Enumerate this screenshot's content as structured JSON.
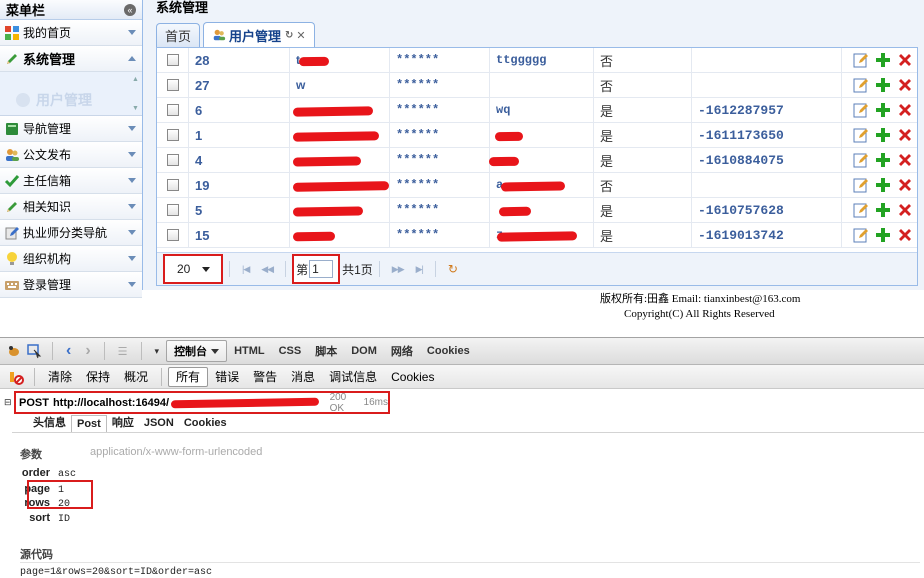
{
  "sidebar": {
    "title": "菜单栏",
    "items": [
      {
        "label": "我的首页",
        "icon": "grid-icon",
        "expanded": false
      },
      {
        "label": "系统管理",
        "icon": "pencil-icon",
        "expanded": true
      },
      {
        "label": "导航管理",
        "icon": "book-icon",
        "expanded": false
      },
      {
        "label": "公文发布",
        "icon": "users-icon",
        "expanded": false
      },
      {
        "label": "主任信箱",
        "icon": "check-icon",
        "expanded": false
      },
      {
        "label": "相关知识",
        "icon": "pencil-icon",
        "expanded": false
      },
      {
        "label": "执业师分类导航",
        "icon": "edit-icon",
        "expanded": false
      },
      {
        "label": "组织机构",
        "icon": "bulb-icon",
        "expanded": false
      },
      {
        "label": "登录管理",
        "icon": "keyboard-icon",
        "expanded": false
      }
    ],
    "sub_item_label": "用户管理"
  },
  "main": {
    "title": "系统管理",
    "tabs": [
      {
        "label": "首页",
        "active": false
      },
      {
        "label": "用户管理",
        "active": true
      }
    ],
    "rows": [
      {
        "id": "28",
        "name": "t",
        "pwd": "******",
        "alias": "ttggggg",
        "flag": "否",
        "phone": ""
      },
      {
        "id": "27",
        "name": "w",
        "pwd": "******",
        "alias": "",
        "flag": "否",
        "phone": ""
      },
      {
        "id": "6",
        "name": "",
        "pwd": "******",
        "alias": "wq",
        "flag": "是",
        "phone": "-1612287957"
      },
      {
        "id": "1",
        "name": "",
        "pwd": "******",
        "alias": "",
        "flag": "是",
        "phone": "-1611173650"
      },
      {
        "id": "4",
        "name": "",
        "pwd": "******",
        "alias": "",
        "flag": "是",
        "phone": "-1610884075"
      },
      {
        "id": "19",
        "name": "",
        "pwd": "******",
        "alias": "a",
        "flag": "否",
        "phone": ""
      },
      {
        "id": "5",
        "name": "",
        "pwd": "******",
        "alias": "",
        "flag": "是",
        "phone": "-1610757628"
      },
      {
        "id": "15",
        "name": "",
        "pwd": "******",
        "alias": "z",
        "flag": "是",
        "phone": "-1619013742"
      }
    ],
    "pager": {
      "page_size": "20",
      "page_prefix": "第",
      "page_value": "1",
      "total": "共1页"
    }
  },
  "footer": {
    "line1": "版权所有:田鑫 Email: tianxinbest@163.com",
    "line2": "Copyright(C) All Rights Reserved"
  },
  "firebug": {
    "main_tabs": [
      "控制台",
      "HTML",
      "CSS",
      "脚本",
      "DOM",
      "网络",
      "Cookies"
    ],
    "console_buttons": [
      "清除",
      "保持",
      "概况",
      "所有",
      "错误",
      "警告",
      "消息",
      "调试信息",
      "Cookies"
    ],
    "request": {
      "method": "POST",
      "url": "http://localhost:16494/",
      "status": "200 OK",
      "time": "16ms"
    },
    "sub_tabs": [
      "头信息",
      "Post",
      "响应",
      "JSON",
      "Cookies"
    ],
    "params_label": "参数",
    "content_type": "application/x-www-form-urlencoded",
    "params": [
      {
        "k": "order",
        "v": "asc"
      },
      {
        "k": "page",
        "v": "1"
      },
      {
        "k": "rows",
        "v": "20"
      },
      {
        "k": "sort",
        "v": "ID"
      }
    ],
    "source_label": "源代码",
    "source": "page=1&rows=20&sort=ID&order=asc"
  },
  "colors": {
    "accent": "#15428b",
    "highlight_box": "#d91c1c",
    "add_icon": "#22a322",
    "delete_icon": "#d42020"
  }
}
